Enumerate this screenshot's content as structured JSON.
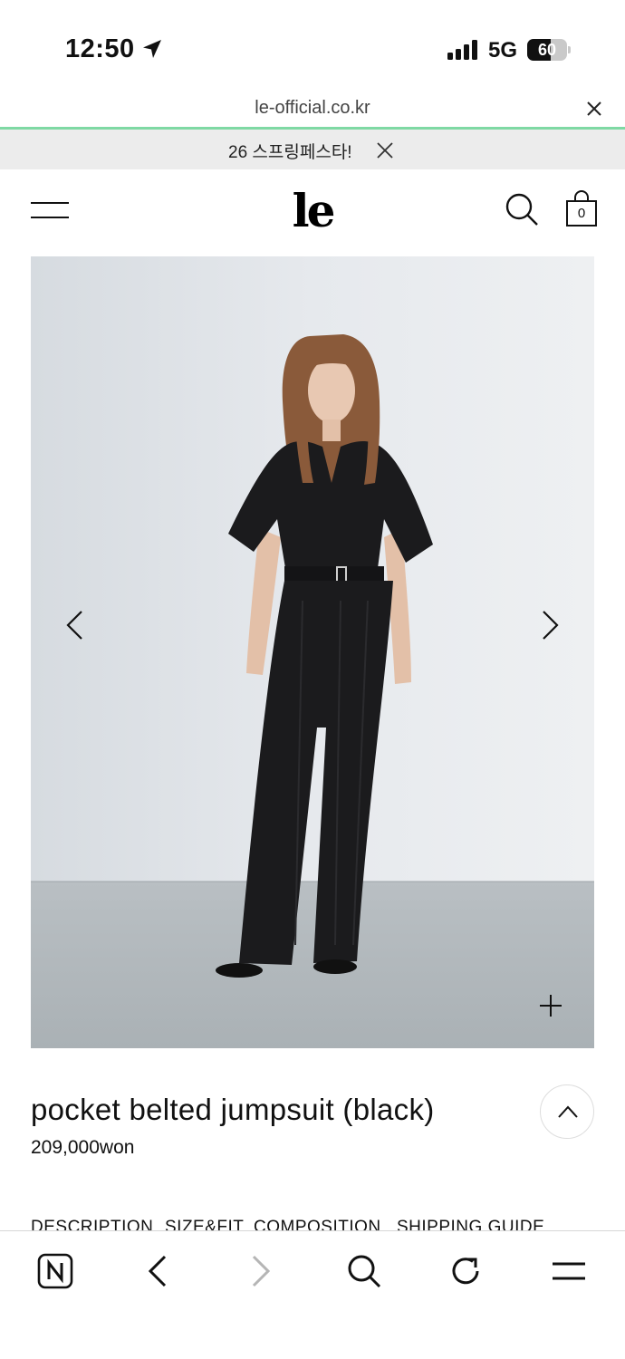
{
  "status_bar": {
    "time": "12:50",
    "network": "5G",
    "battery_level": "60",
    "battery_fraction": 0.6
  },
  "browser": {
    "url": "le-official.co.kr"
  },
  "promo_banner": {
    "text": "26 스프링페스타!"
  },
  "header": {
    "logo_text": "le",
    "cart_count": "0"
  },
  "product": {
    "title": "pocket belted jumpsuit (black)",
    "price": "209,000won"
  },
  "tabs": [
    "DESCRIPTION",
    "SIZE&FIT",
    "COMPOSITION",
    "SHIPPING GUIDE"
  ],
  "icons": {
    "menu": "hamburger-menu-icon",
    "search": "search-icon",
    "cart": "shopping-bag-icon",
    "prev": "chevron-left-icon",
    "next": "chevron-right-icon",
    "zoom": "plus-icon",
    "top": "chevron-up-icon"
  },
  "colors": {
    "progress": "#7fd9a4",
    "banner_bg": "#ececec",
    "photo_wall": "#e4e8ec",
    "photo_floor": "#b6bcbf",
    "garment": "#1b1b1d"
  }
}
